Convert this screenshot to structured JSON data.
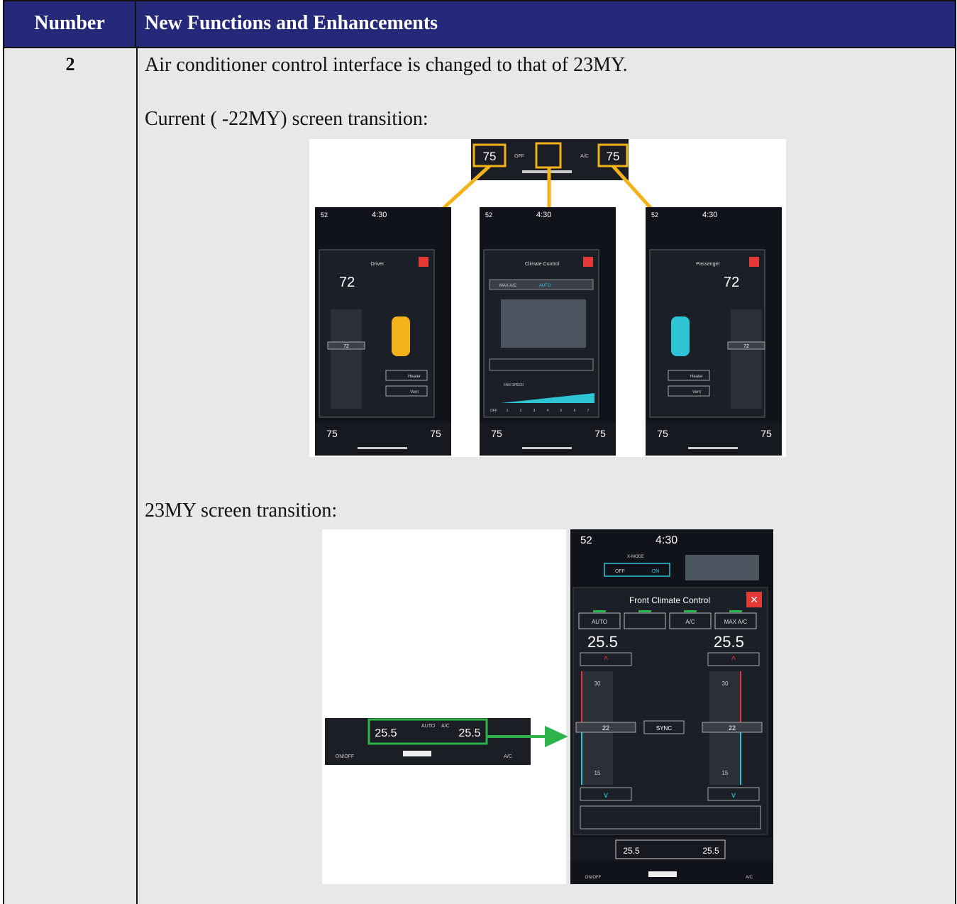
{
  "header": {
    "col1": "Number",
    "col2": "New Functions and Enhancements"
  },
  "row": {
    "number": "2",
    "line1": "Air conditioner control interface is changed to that of 23MY.",
    "current_label": "Current ( -22MY) screen transition:",
    "new_label": "23MY screen transition:"
  },
  "fig_current": {
    "temp_left": "75",
    "temp_right": "75",
    "off_label": "OFF",
    "ac_label": "A/C",
    "status_time": "4:30",
    "outside_temp": "52",
    "screens": [
      {
        "title": "Driver",
        "set_temp": "72",
        "mid_value": "72",
        "btn1": "Heater",
        "btn2": "Vent"
      },
      {
        "title": "Climate Control",
        "max_ac": "MAX A/C",
        "auto": "AUTO",
        "fan_speed": "FAN SPEED",
        "fan_scale": [
          "OFF",
          "1",
          "2",
          "3",
          "4",
          "5",
          "6",
          "7"
        ]
      },
      {
        "title": "Passenger",
        "set_temp": "72",
        "mid_value": "72",
        "btn1": "Heater",
        "btn2": "Vent"
      }
    ]
  },
  "fig_23my": {
    "outside_temp": "52",
    "time": "4:30",
    "xmode": "X-MODE",
    "xmode_off": "OFF",
    "xmode_on": "ON",
    "panel_title": "Front Climate Control",
    "buttons": [
      "AUTO",
      "",
      "A/C",
      "MAX A/C"
    ],
    "temp_left": "25.5",
    "temp_right": "25.5",
    "scale_hi": "30",
    "scale_mid": "22",
    "scale_lo": "15",
    "sync": "SYNC",
    "bar_auto": "AUTO",
    "bar_ac": "A/C",
    "on_off": "ON/OFF",
    "bottom_ac": "A/C"
  },
  "colors": {
    "header_bg": "#26297a",
    "row_bg": "#e8e8e9",
    "arrow_orange": "#f2b21b",
    "arrow_green": "#2db34a",
    "accent_red": "#e53935",
    "accent_teal": "#2ec4d4"
  }
}
